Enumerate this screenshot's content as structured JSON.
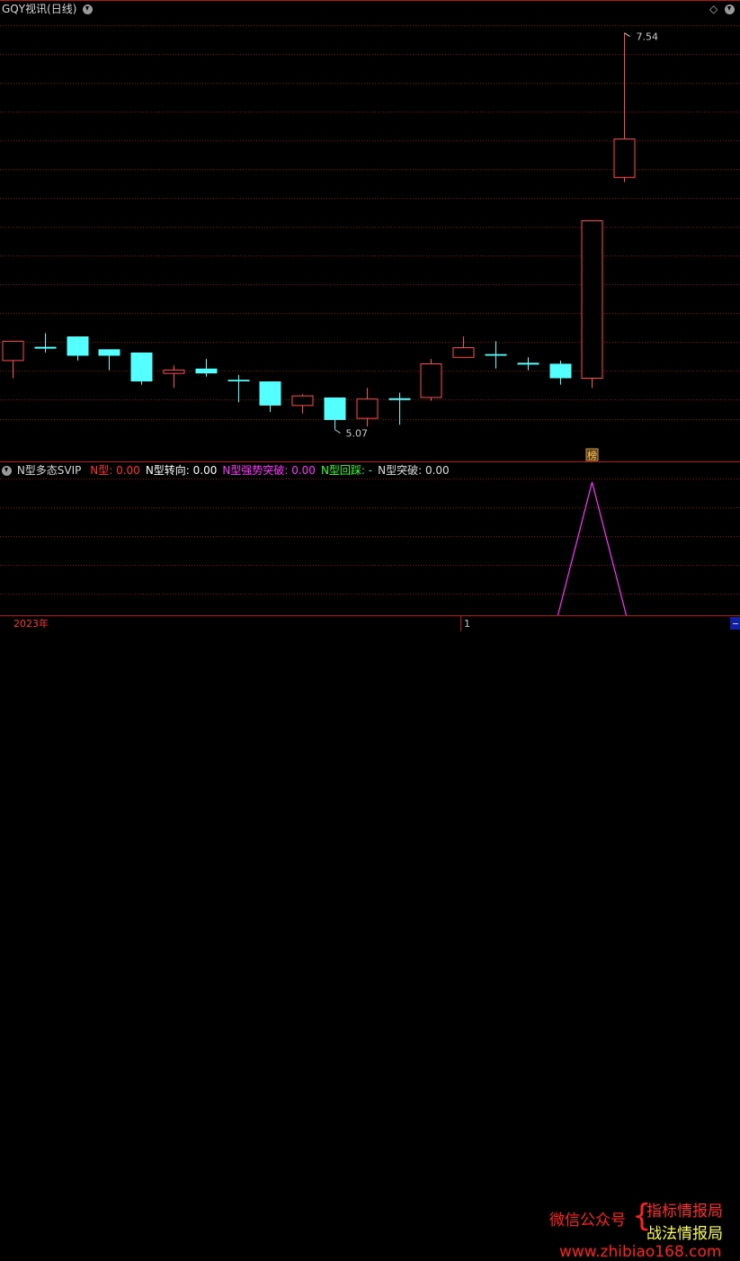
{
  "main_title": "GQY视讯(日线)",
  "sub_title": "N型多态SVIP",
  "indicators": [
    {
      "label": "N型: 0.00",
      "color": "#ff3030"
    },
    {
      "label": "N型转向: 0.00",
      "color": "#ffffff"
    },
    {
      "label": "N型强势突破: 0.00",
      "color": "#ff33ff"
    },
    {
      "label": "N型回踩: -",
      "color": "#33ff33"
    },
    {
      "label": "N型突破: 0.00",
      "color": "#dddddd"
    }
  ],
  "year_label": "2023年",
  "page_marker": "1",
  "badge": "榜",
  "price_max_label": "7.54",
  "price_min_label": "5.07",
  "watermark": {
    "left": "微信公众号",
    "right_top": "指标情报局",
    "right_bottom": "战法情报局",
    "url": "www.zhibiao168.com"
  },
  "colors": {
    "up": "#ff4a4a",
    "down": "#54ffff",
    "grid": "#8a1010",
    "frame": "#b01818",
    "signal": "#ff33ff"
  },
  "chart_data": {
    "type": "candlestick",
    "price_range": [
      4.9,
      7.7
    ],
    "candles": [
      {
        "open": 5.5,
        "high": 5.52,
        "low": 5.39,
        "close": 5.62,
        "dir": "up"
      },
      {
        "open": 5.58,
        "high": 5.67,
        "low": 5.55,
        "close": 5.58,
        "dir": "flat"
      },
      {
        "open": 5.65,
        "high": 5.65,
        "low": 5.5,
        "close": 5.53,
        "dir": "down"
      },
      {
        "open": 5.57,
        "high": 5.57,
        "low": 5.44,
        "close": 5.53,
        "dir": "down"
      },
      {
        "open": 5.55,
        "high": 5.55,
        "low": 5.35,
        "close": 5.37,
        "dir": "down"
      },
      {
        "open": 5.42,
        "high": 5.47,
        "low": 5.33,
        "close": 5.44,
        "dir": "up"
      },
      {
        "open": 5.45,
        "high": 5.51,
        "low": 5.4,
        "close": 5.42,
        "dir": "down"
      },
      {
        "open": 5.38,
        "high": 5.41,
        "low": 5.24,
        "close": 5.37,
        "dir": "down"
      },
      {
        "open": 5.37,
        "high": 5.37,
        "low": 5.18,
        "close": 5.22,
        "dir": "down"
      },
      {
        "open": 5.22,
        "high": 5.29,
        "low": 5.17,
        "close": 5.28,
        "dir": "up"
      },
      {
        "open": 5.27,
        "high": 5.27,
        "low": 5.07,
        "close": 5.13,
        "dir": "down"
      },
      {
        "open": 5.14,
        "high": 5.33,
        "low": 5.09,
        "close": 5.26,
        "dir": "up"
      },
      {
        "open": 5.26,
        "high": 5.3,
        "low": 5.1,
        "close": 5.26,
        "dir": "flat"
      },
      {
        "open": 5.27,
        "high": 5.51,
        "low": 5.25,
        "close": 5.48,
        "dir": "up"
      },
      {
        "open": 5.52,
        "high": 5.65,
        "low": 5.52,
        "close": 5.58,
        "dir": "up"
      },
      {
        "open": 5.54,
        "high": 5.62,
        "low": 5.45,
        "close": 5.53,
        "dir": "down"
      },
      {
        "open": 5.48,
        "high": 5.52,
        "low": 5.44,
        "close": 5.48,
        "dir": "flat"
      },
      {
        "open": 5.48,
        "high": 5.5,
        "low": 5.35,
        "close": 5.39,
        "dir": "down"
      },
      {
        "open": 5.39,
        "high": 6.37,
        "low": 5.33,
        "close": 6.37,
        "dir": "up"
      },
      {
        "open": 6.64,
        "high": 7.54,
        "low": 6.61,
        "close": 6.88,
        "dir": "up"
      }
    ],
    "signal_peak": {
      "index": 18,
      "value": 1
    }
  }
}
